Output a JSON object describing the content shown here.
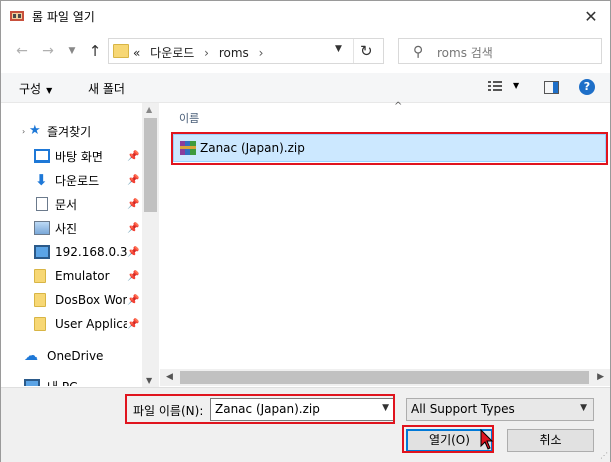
{
  "window": {
    "title": "롬 파일 열기",
    "close_glyph": "✕"
  },
  "navigation": {
    "back_glyph": "←",
    "forward_glyph": "→",
    "up_glyph": "↑",
    "breadcrumb_prefix": "«",
    "breadcrumb": [
      "다운로드",
      "roms"
    ],
    "breadcrumb_separator": "›",
    "refresh_glyph": "↻",
    "search_placeholder": "roms 검색"
  },
  "toolbar": {
    "organize_label": "구성",
    "new_folder_label": "새 폴더",
    "help_glyph": "?"
  },
  "sidebar": {
    "quick_access_label": "즐겨찾기",
    "items": [
      {
        "label": "바탕 화면",
        "icon": "desktop-icon",
        "pinned": true
      },
      {
        "label": "다운로드",
        "icon": "download-icon",
        "pinned": true
      },
      {
        "label": "문서",
        "icon": "document-icon",
        "pinned": true
      },
      {
        "label": "사진",
        "icon": "pictures-icon",
        "pinned": true
      },
      {
        "label": "192.168.0.3",
        "icon": "network-pc-icon",
        "pinned": true
      },
      {
        "label": "Emulator",
        "icon": "folder-icon",
        "pinned": true
      },
      {
        "label": "DosBox Work",
        "icon": "folder-icon",
        "pinned": true
      },
      {
        "label": "User Applicat",
        "icon": "folder-icon",
        "pinned": true
      }
    ],
    "onedrive_label": "OneDrive",
    "pc_label": "내 PC",
    "pin_glyph": "📌"
  },
  "file_list": {
    "column_name": "이름",
    "files": [
      {
        "name": "Zanac (Japan).zip",
        "icon": "winrar-archive-icon",
        "selected": true
      }
    ]
  },
  "footer": {
    "filename_label": "파일 이름(N):",
    "filename_value": "Zanac (Japan).zip",
    "filetype_value": "All Support Types",
    "open_label": "열기(O)",
    "cancel_label": "취소"
  },
  "colors": {
    "highlight_red": "#e0141e",
    "selection_fill": "#cce8ff",
    "accent_blue": "#0078d7"
  }
}
